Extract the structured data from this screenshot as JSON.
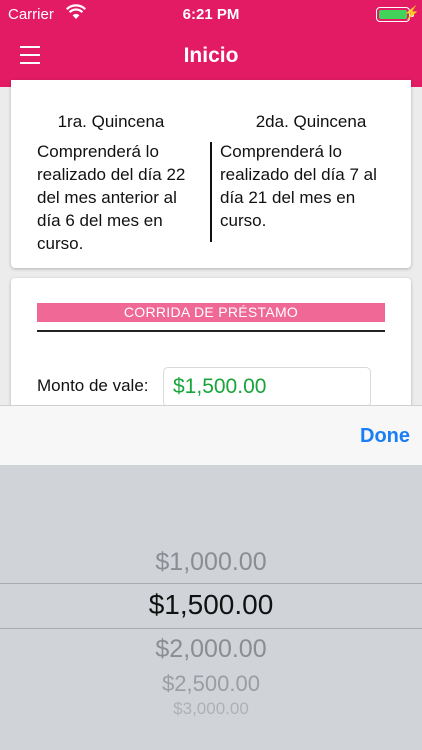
{
  "status_bar": {
    "carrier": "Carrier",
    "time": "6:21 PM",
    "battery_icon": "battery-icon",
    "wifi_icon": "wifi-icon",
    "charging_icon": "bolt-icon"
  },
  "header": {
    "title": "Inicio",
    "menu_icon": "hamburger-menu-icon",
    "color": "#e21b64"
  },
  "quincenas": {
    "first": {
      "title": "1ra. Quincena",
      "text": "Comprenderá lo realizado del día 22 del mes anterior al día 6 del mes en curso."
    },
    "second": {
      "title": "2da. Quincena",
      "text": "Comprenderá lo realizado del día 7 al día 21 del mes en curso."
    }
  },
  "prestamo": {
    "banner": "CORRIDA DE PRÉSTAMO",
    "banner_color": "#f06996",
    "monto_label": "Monto de vale:",
    "monto_value": "$1,500.00",
    "value_color": "#19a53b"
  },
  "picker": {
    "done_label": "Done",
    "accent": "#1a7ef5",
    "options": [
      "$1,000.00",
      "$1,500.00",
      "$2,000.00",
      "$2,500.00",
      "$3,000.00"
    ],
    "selected": "$1,500.00"
  }
}
